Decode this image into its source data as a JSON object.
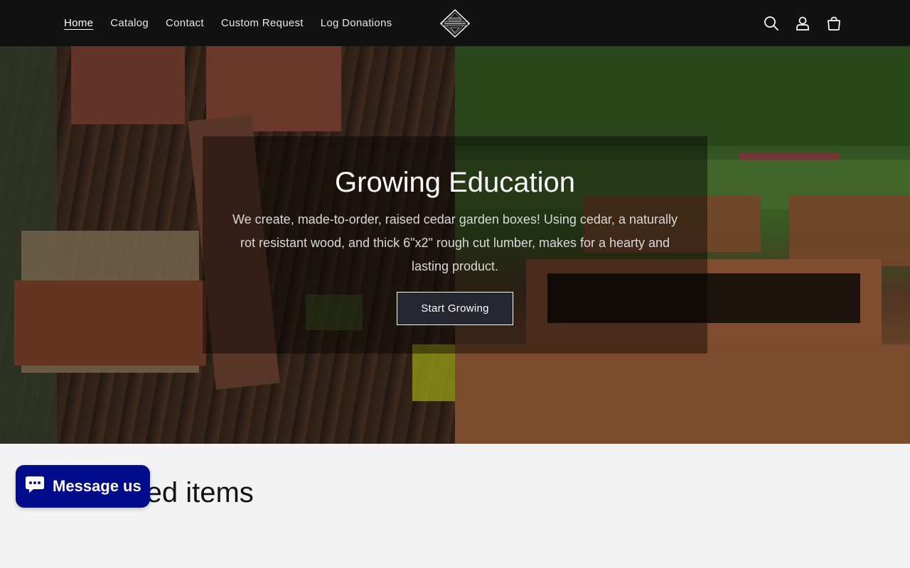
{
  "nav": {
    "items": [
      {
        "label": "Home",
        "active": true
      },
      {
        "label": "Catalog"
      },
      {
        "label": "Contact"
      },
      {
        "label": "Custom Request"
      },
      {
        "label": "Log Donations"
      }
    ]
  },
  "header": {
    "logo_text": "123gardenboxes.com",
    "icons": [
      "search-icon",
      "account-icon",
      "cart-icon"
    ]
  },
  "hero": {
    "title": "Growing Education",
    "text": "We create, made-to-order, raised cedar garden boxes! Using cedar, a naturally rot resistant wood, and thick 6\"x2\" rough cut lumber, makes for a hearty and lasting product.",
    "button_label": "Start Growing"
  },
  "featured": {
    "title": "Featured items"
  },
  "chat": {
    "label": "Message us"
  },
  "colors": {
    "header_bg": "#121212",
    "page_bg": "#f3f3f3",
    "chat_bg": "#000c8a",
    "button_bg": "#24272f"
  }
}
